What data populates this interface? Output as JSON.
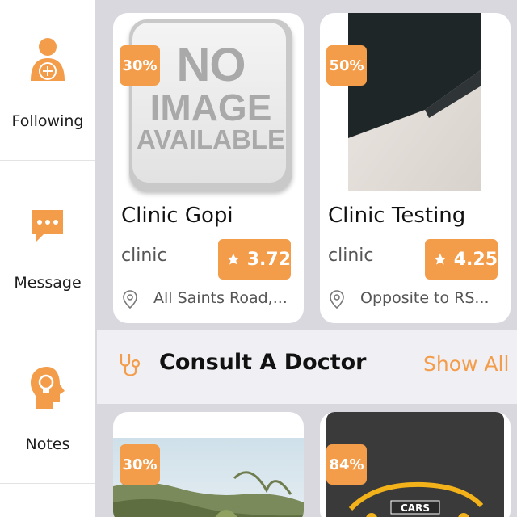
{
  "sidebar": {
    "items": [
      {
        "label": "Following",
        "icon": "user-add-icon"
      },
      {
        "label": "Message",
        "icon": "chat-icon"
      },
      {
        "label": "Notes",
        "icon": "head-bulb-icon"
      }
    ]
  },
  "clinics": [
    {
      "discount": "30%",
      "name": "Clinic Gopi",
      "type": "clinic",
      "rating": "3.72",
      "address": "All Saints Road,...",
      "image_text": [
        "NO",
        "IMAGE",
        "AVAILABLE"
      ]
    },
    {
      "discount": "50%",
      "name": "Clinic Testing",
      "type": "clinic",
      "rating": "4.25",
      "address": "Opposite to RS..."
    }
  ],
  "section": {
    "title": "Consult A Doctor",
    "show_all": "Show All",
    "icon": "stethoscope-icon"
  },
  "doctors": [
    {
      "discount": "30%"
    },
    {
      "discount": "84%",
      "logo_text": "CARS"
    }
  ],
  "colors": {
    "accent": "#f39c4a",
    "background": "#d9d8de",
    "card": "#ffffff"
  }
}
